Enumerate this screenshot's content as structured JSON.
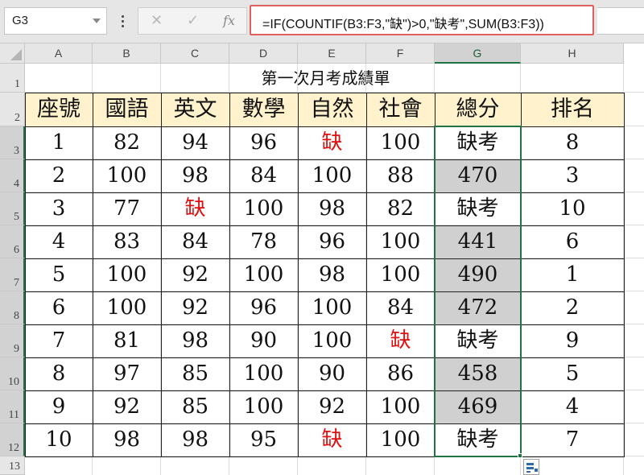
{
  "name_box": "G3",
  "formula": "=IF(COUNTIF(B3:F3,\"缺\")>0,\"缺考\",SUM(B3:F3))",
  "formula_buttons": {
    "cancel": "✕",
    "enter": "✓",
    "fx": "fx"
  },
  "columns": [
    "A",
    "B",
    "C",
    "D",
    "E",
    "F",
    "G",
    "H"
  ],
  "rows": [
    "1",
    "2",
    "3",
    "4",
    "5",
    "6",
    "7",
    "8",
    "9",
    "10",
    "11",
    "12",
    "13"
  ],
  "sheet_title": "第一次月考成績單",
  "table": {
    "headers": [
      "座號",
      "國語",
      "英文",
      "數學",
      "自然",
      "社會",
      "總分",
      "排名"
    ],
    "rows": [
      [
        "1",
        "82",
        "94",
        "96",
        "缺",
        "100",
        "缺考",
        "8"
      ],
      [
        "2",
        "100",
        "98",
        "84",
        "100",
        "88",
        "470",
        "3"
      ],
      [
        "3",
        "77",
        "缺",
        "100",
        "98",
        "82",
        "缺考",
        "10"
      ],
      [
        "4",
        "83",
        "84",
        "78",
        "96",
        "100",
        "441",
        "6"
      ],
      [
        "5",
        "100",
        "92",
        "100",
        "98",
        "100",
        "490",
        "1"
      ],
      [
        "6",
        "100",
        "92",
        "96",
        "100",
        "84",
        "472",
        "2"
      ],
      [
        "7",
        "81",
        "98",
        "90",
        "100",
        "缺",
        "缺考",
        "9"
      ],
      [
        "8",
        "97",
        "85",
        "100",
        "90",
        "86",
        "458",
        "5"
      ],
      [
        "9",
        "92",
        "85",
        "100",
        "92",
        "100",
        "469",
        "4"
      ],
      [
        "10",
        "98",
        "98",
        "95",
        "缺",
        "100",
        "缺考",
        "7"
      ]
    ]
  },
  "colors": {
    "header_fill": "#fff2cc",
    "absent_text": "#e01010",
    "selection": "#217346",
    "selected_fill": "#d0d0d0",
    "formula_highlight": "#e06060"
  }
}
